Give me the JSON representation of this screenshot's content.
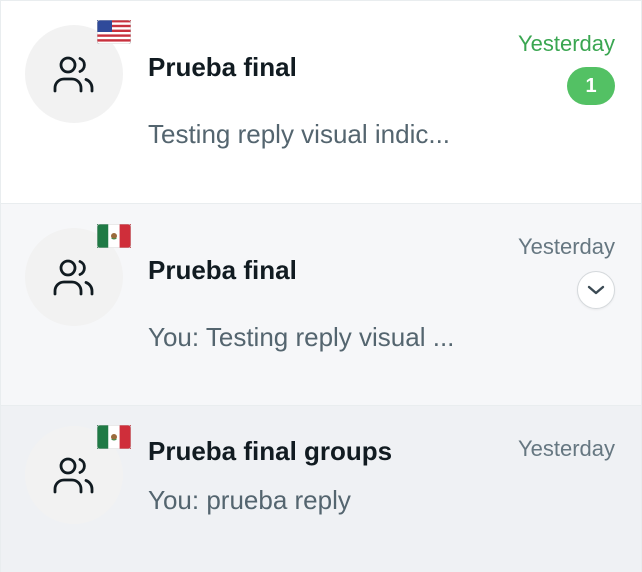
{
  "chats": [
    {
      "title": "Prueba final",
      "preview": "Testing reply visual indic...",
      "time": "Yesterday",
      "unread_count": "1",
      "flag": "us-flag",
      "avatar_icon": "group-icon",
      "time_color": "#3aa651",
      "badge_color": "#53c164"
    },
    {
      "title": "Prueba final",
      "preview": "You: Testing reply visual ...",
      "time": "Yesterday",
      "flag": "mexico-flag",
      "avatar_icon": "group-icon",
      "action_icon": "chevron-down-icon"
    },
    {
      "title": "Prueba final groups",
      "preview": "You: prueba reply",
      "time": "Yesterday",
      "flag": "mexico-flag",
      "avatar_icon": "group-icon"
    }
  ]
}
